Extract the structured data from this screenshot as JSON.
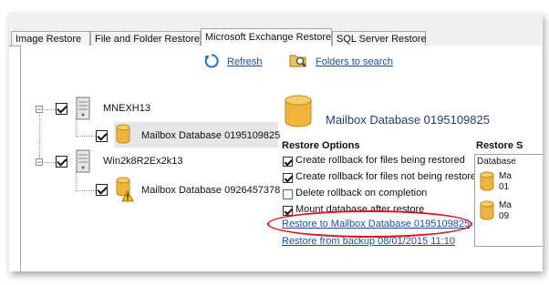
{
  "tabs": [
    {
      "label": "Image Restore",
      "active": false
    },
    {
      "label": "File and Folder Restore",
      "active": false
    },
    {
      "label": "Microsoft Exchange Restore",
      "active": true
    },
    {
      "label": "SQL Server Restore",
      "active": false
    }
  ],
  "toolbar": {
    "refresh_label": "Refresh",
    "folders_label": "Folders to search"
  },
  "tree": {
    "server1": "MNEXH13",
    "server1_db": "Mailbox Database 0195109825",
    "server2": "Win2k8R2Ex2k13",
    "server2_db": "Mailbox Database 0926457378"
  },
  "detail": {
    "db_title": "Mailbox Database 0195109825",
    "restore_options_title": "Restore Options",
    "options": [
      {
        "label": "Create rollback for files being restored",
        "checked": true
      },
      {
        "label": "Create rollback for files not being restore",
        "checked": true
      },
      {
        "label": "Delete rollback on completion",
        "checked": false
      },
      {
        "label": "Mount database after restore",
        "checked": true
      }
    ],
    "restore_to_link": "Restore to Mailbox Database 0195109825",
    "restore_from_link": "Restore from backup 08/01/2015 11:10"
  },
  "restore_panel": {
    "title": "Restore S",
    "col_header": "Database",
    "items": [
      {
        "line1": "Ma",
        "line2": "01"
      },
      {
        "line1": "Ma",
        "line2": "09"
      }
    ]
  },
  "colors": {
    "link": "#1a4fa0",
    "highlight_oval": "#d8141c",
    "db_icon": "#f0b43c"
  },
  "icons": [
    "refresh-icon",
    "folder-search-icon",
    "server-icon",
    "database-icon",
    "warning-icon"
  ]
}
